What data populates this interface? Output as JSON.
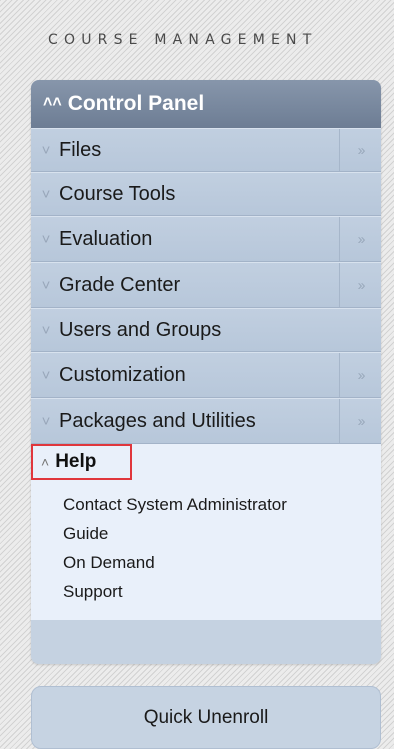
{
  "section_heading": "COURSE MANAGEMENT",
  "control_panel": {
    "title": "Control Panel",
    "items": [
      {
        "label": "Files",
        "has_arrow": true
      },
      {
        "label": "Course Tools",
        "has_arrow": false
      },
      {
        "label": "Evaluation",
        "has_arrow": true
      },
      {
        "label": "Grade Center",
        "has_arrow": true
      },
      {
        "label": "Users and Groups",
        "has_arrow": false
      },
      {
        "label": "Customization",
        "has_arrow": true
      },
      {
        "label": "Packages and Utilities",
        "has_arrow": true
      }
    ],
    "help": {
      "title": "Help",
      "links": [
        "Contact System Administrator",
        "Guide",
        "On Demand",
        "Support"
      ]
    }
  },
  "quick_unenroll_label": "Quick Unenroll",
  "icons": {
    "expanded": "chevron-up-double-icon",
    "collapsed": "chevron-down-double-icon",
    "submenu": "chevron-right-double-icon"
  },
  "colors": {
    "header_bg": "#7a8aa0",
    "item_bg": "#bccbde",
    "help_bg": "#e9f0fa",
    "highlight_border": "#e0363c"
  }
}
